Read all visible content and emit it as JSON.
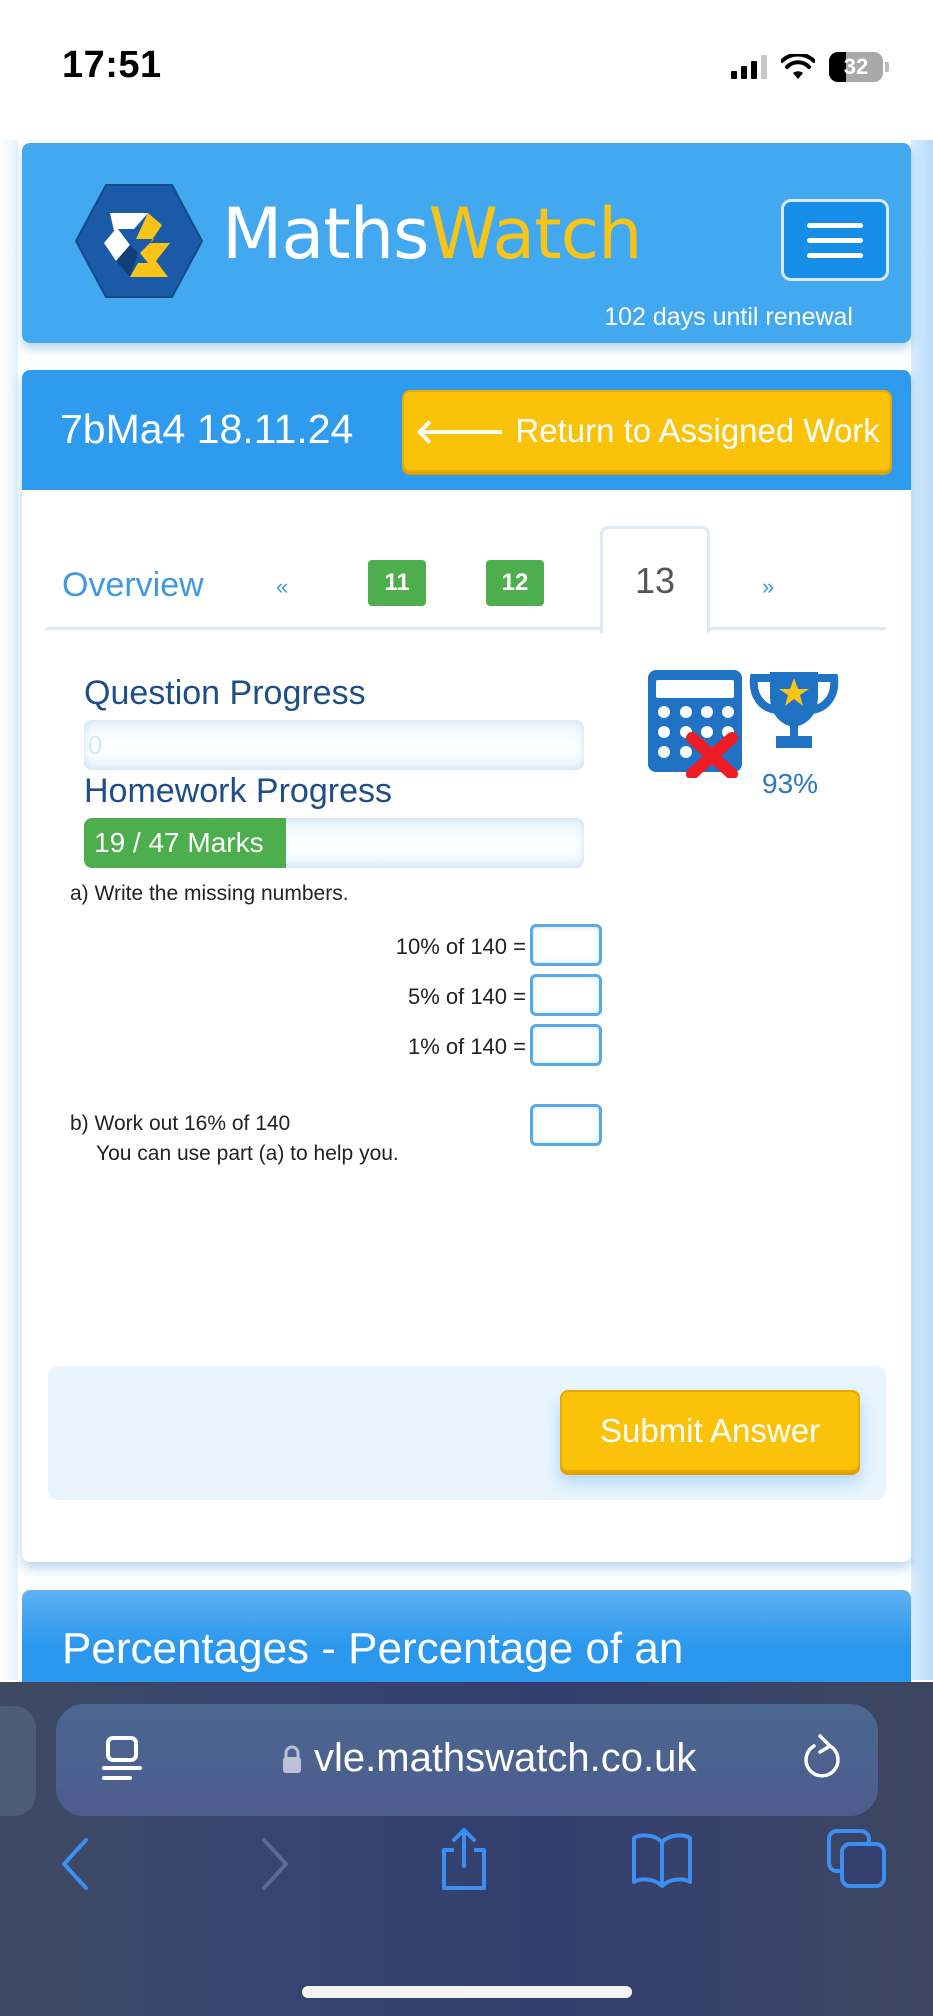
{
  "status_bar": {
    "time": "17:51",
    "battery_level": "32",
    "signal_icon": "cellular-signal-icon",
    "wifi_icon": "wifi-icon"
  },
  "header": {
    "brand_part1": "Maths",
    "brand_part2": "Watch",
    "renewal_text": "102 days until renewal",
    "menu_icon": "hamburger-menu-icon",
    "colors": {
      "header_bg": "#42a8f0",
      "brand_accent": "#f8c417"
    }
  },
  "assignment": {
    "title": "7bMa4 18.11.24",
    "return_button_label": "Return to Assigned Work",
    "return_icon": "arrow-left-icon"
  },
  "tabs": {
    "overview_label": "Overview",
    "prev_label": "«",
    "next_label": "»",
    "items": [
      {
        "label": "11",
        "status": "completed"
      },
      {
        "label": "12",
        "status": "completed"
      },
      {
        "label": "13",
        "status": "active"
      }
    ]
  },
  "progress": {
    "question_label": "Question Progress",
    "question_value": "0",
    "question_fraction": 0,
    "homework_label": "Homework Progress",
    "homework_text": "19 / 47 Marks",
    "homework_marks": 19,
    "homework_total": 47,
    "calculator_icon": "no-calculator-icon",
    "trophy_icon": "trophy-icon",
    "score": "93%"
  },
  "question": {
    "part_a": "a) Write the missing numbers.",
    "equations": [
      {
        "label": "10% of 140 =",
        "value": ""
      },
      {
        "label": "5% of 140 =",
        "value": ""
      },
      {
        "label": "1% of 140 =",
        "value": ""
      }
    ],
    "part_b_line1": "b) Work out 16% of 140",
    "part_b_line2": "You can use part (a) to help you.",
    "part_b_value": "",
    "submit_label": "Submit Answer"
  },
  "next_section": {
    "title": "Percentages - Percentage of an"
  },
  "browser": {
    "url": "vle.mathswatch.co.uk",
    "icons": [
      "reader-icon",
      "lock-icon",
      "reload-icon",
      "back-icon",
      "forward-icon",
      "share-icon",
      "bookmarks-icon",
      "tabs-icon"
    ]
  }
}
